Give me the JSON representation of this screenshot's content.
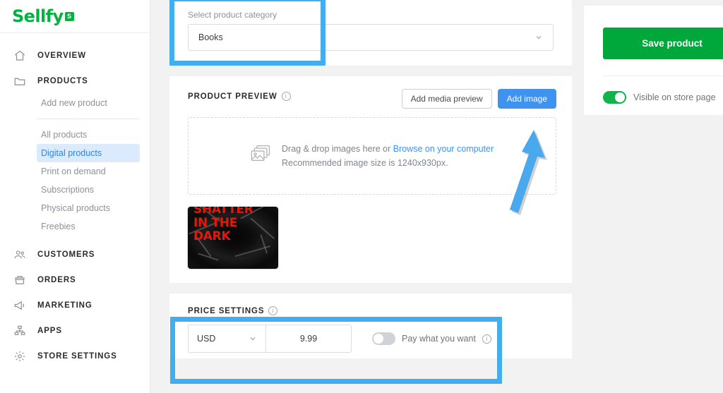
{
  "brand": {
    "name": "Sellfy",
    "badge": "S",
    "color": "#00b341"
  },
  "sidebar": {
    "items": [
      {
        "label": "OVERVIEW",
        "icon": "home-icon"
      },
      {
        "label": "PRODUCTS",
        "icon": "folder-icon"
      }
    ],
    "product_sub": [
      {
        "label": "Add new product",
        "active": false
      },
      {
        "label": "All products",
        "active": false
      },
      {
        "label": "Digital products",
        "active": true
      },
      {
        "label": "Print on demand",
        "active": false
      },
      {
        "label": "Subscriptions",
        "active": false
      },
      {
        "label": "Physical products",
        "active": false
      },
      {
        "label": "Freebies",
        "active": false
      }
    ],
    "lower_items": [
      {
        "label": "CUSTOMERS",
        "icon": "people-icon"
      },
      {
        "label": "ORDERS",
        "icon": "basket-icon"
      },
      {
        "label": "MARKETING",
        "icon": "megaphone-icon"
      },
      {
        "label": "APPS",
        "icon": "apps-icon"
      },
      {
        "label": "STORE SETTINGS",
        "icon": "gear-icon"
      }
    ]
  },
  "category": {
    "label": "Select product category",
    "value": "Books",
    "chevron": "chevron-down-icon"
  },
  "product_preview": {
    "title": "PRODUCT PREVIEW",
    "info": "i",
    "add_media_label": "Add media preview",
    "add_image_label": "Add image",
    "dropzone": {
      "line1_prefix": "Drag & drop images here or ",
      "line1_link": "Browse on your computer",
      "line2": "Recommended image size is 1240x930px."
    },
    "thumbnail": {
      "line1": "SHATTER",
      "line2": "IN THE",
      "line3": "DARK",
      "text_color": "#e01b0e"
    }
  },
  "price_settings": {
    "title": "PRICE SETTINGS",
    "info": "i",
    "currency": "USD",
    "amount": "9.99",
    "pay_what_you_want_label": "Pay what you want",
    "pay_what_you_want_on": false
  },
  "right_panel": {
    "save_label": "Save product",
    "save_color": "#00a83c",
    "visible_label": "Visible on store page",
    "visible_on": true
  },
  "annotations": {
    "highlight_color": "#43aeed",
    "arrow_color": "#4aa9ec",
    "boxes": [
      {
        "name": "category-highlight"
      },
      {
        "name": "price-settings-highlight"
      }
    ]
  }
}
